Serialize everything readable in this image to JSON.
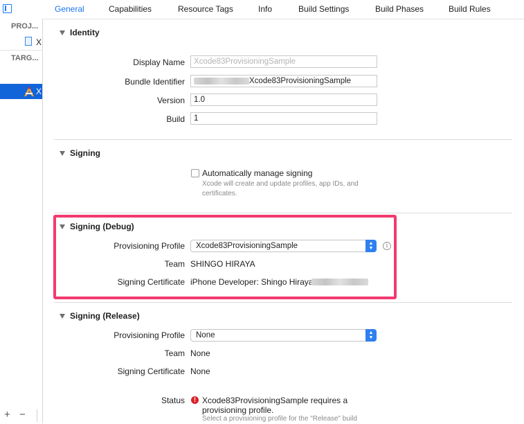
{
  "tabs": [
    "General",
    "Capabilities",
    "Resource Tags",
    "Info",
    "Build Settings",
    "Build Phases",
    "Build Rules"
  ],
  "sidebar": {
    "project_header": "PROJ...",
    "project_item": "X",
    "targets_header": "TARG...",
    "target_item": "X",
    "add_label": "+",
    "remove_label": "−"
  },
  "identity": {
    "title": "Identity",
    "display_name_label": "Display Name",
    "display_name_placeholder": "Xcode83ProvisioningSample",
    "bundle_identifier_label": "Bundle Identifier",
    "bundle_identifier_value": "Xcode83ProvisioningSample",
    "version_label": "Version",
    "version_value": "1.0",
    "build_label": "Build",
    "build_value": "1"
  },
  "signing": {
    "title": "Signing",
    "auto_label": "Automatically manage signing",
    "auto_note_1": "Xcode will create and update profiles, app IDs, and",
    "auto_note_2": "certificates."
  },
  "signing_debug": {
    "title": "Signing (Debug)",
    "profile_label": "Provisioning Profile",
    "profile_value": "Xcode83ProvisioningSample",
    "team_label": "Team",
    "team_value": "SHINGO HIRAYA",
    "cert_label": "Signing Certificate",
    "cert_value": "iPhone Developer: Shingo Hiraya"
  },
  "signing_release": {
    "title": "Signing (Release)",
    "profile_label": "Provisioning Profile",
    "profile_value": "None",
    "team_label": "Team",
    "team_value": "None",
    "cert_label": "Signing Certificate",
    "cert_value": "None",
    "status_label": "Status",
    "status_line_1": "Xcode83ProvisioningSample requires a",
    "status_line_2": "provisioning profile.",
    "status_note": "Select a provisioning profile for the \"Release\" build"
  },
  "colors": {
    "accent": "#1a74f0",
    "highlight": "#f23a6f",
    "error": "#d9232a",
    "selection": "#1264d9"
  }
}
